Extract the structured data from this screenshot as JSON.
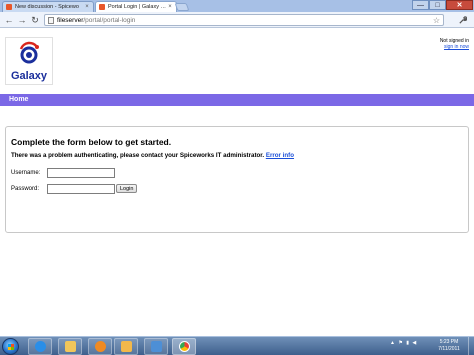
{
  "browser": {
    "tabs": [
      {
        "label": "New discussion - Spicewo",
        "close": "×",
        "active": false
      },
      {
        "label": "Portal Login | Galaxy Intellig",
        "close": "×",
        "active": true
      }
    ],
    "window_controls": {
      "minimize": "—",
      "maximize": "□",
      "close": "✕"
    },
    "nav": {
      "back": "←",
      "forward": "→",
      "reload": "↻"
    },
    "address": {
      "host": "fileserver",
      "path": "/portal/portal-login"
    },
    "star": "☆",
    "wrench": "🔧"
  },
  "header": {
    "logo_text": "Galaxy",
    "user_status": "Not signed in",
    "sign_in_link": "sign in now"
  },
  "navbar": {
    "home_label": "Home"
  },
  "form": {
    "heading": "Complete the form below to get started.",
    "error_message": "There was a problem authenticating, please contact your Spiceworks IT administrator.",
    "error_link": "Error info",
    "username_label": "Username:",
    "username_value": "",
    "password_label": "Password:",
    "password_value": "",
    "login_button": "Login"
  },
  "scrollbar": {
    "left": "◀",
    "right": "▶"
  },
  "taskbar": {
    "items": [
      {
        "icon": "ie-icon",
        "color": "#2a8ee8"
      },
      {
        "icon": "folder-icon",
        "color": "#f1c65a"
      },
      {
        "icon": "media-icon",
        "color": "#f08a22"
      },
      {
        "icon": "outlook-icon",
        "color": "#f2b84b"
      },
      {
        "icon": "network-icon",
        "color": "#4d8fd6"
      },
      {
        "icon": "chrome-icon",
        "color": "#e94235"
      }
    ],
    "tray_icons": "▲ ⚑ ▮ ◀",
    "time": "5:23 PM",
    "date": "7/11/2011"
  }
}
